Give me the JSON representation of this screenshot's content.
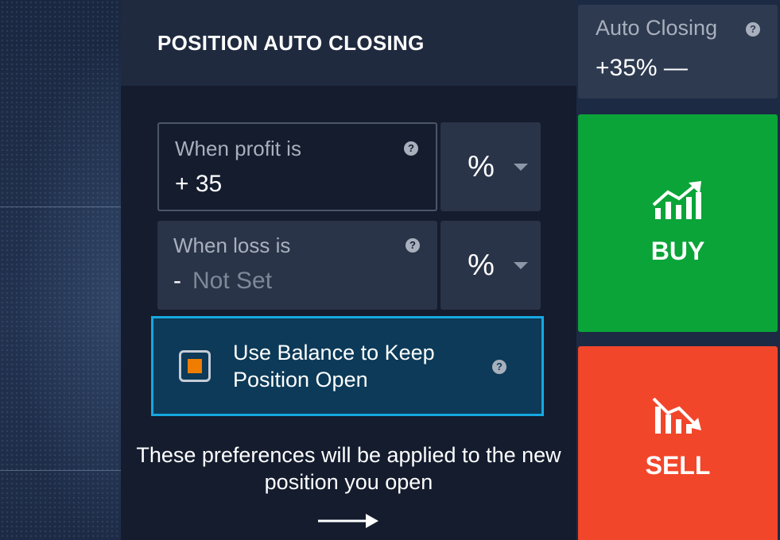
{
  "panel": {
    "title": "POSITION AUTO CLOSING",
    "profit": {
      "label": "When profit is",
      "value": "+ 35",
      "unit": "%"
    },
    "loss": {
      "label": "When loss is",
      "sign": "-",
      "placeholder": "Not Set",
      "unit": "%"
    },
    "balance_option": {
      "label": "Use Balance to Keep Position Open",
      "checked": true
    },
    "note": "These preferences will be applied to the new position you open"
  },
  "right": {
    "auto_closing": {
      "label": "Auto Closing",
      "value": "+35% —"
    },
    "buy": {
      "label": "BUY",
      "icon": "trend-up-icon"
    },
    "sell": {
      "label": "SELL",
      "icon": "trend-down-icon"
    }
  },
  "help_glyph": "?",
  "colors": {
    "buy": "#0aa438",
    "sell": "#f2462a",
    "highlight_border": "#16a8e0",
    "checkbox_mark": "#f07d00"
  }
}
